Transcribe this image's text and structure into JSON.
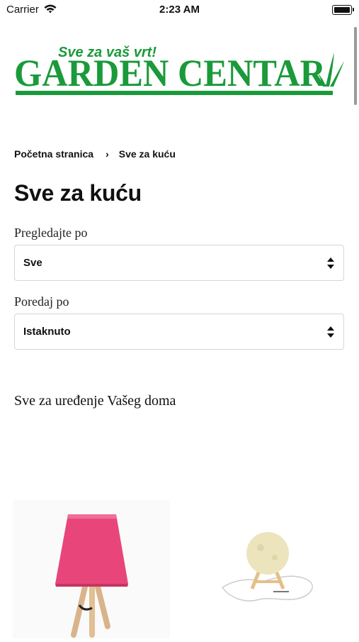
{
  "status": {
    "carrier": "Carrier",
    "time": "2:23 AM"
  },
  "logo": {
    "tagline": "Sve za vaš vrt!",
    "name": "GARDEN CENTAR"
  },
  "breadcrumb": {
    "home": "Početna stranica",
    "separator": "›",
    "current": "Sve za kuću"
  },
  "page": {
    "title": "Sve za kuću",
    "intro": "Sve za  uređenje Vašeg doma"
  },
  "filters": {
    "browse_label": "Pregledajte po",
    "browse_value": "Sve",
    "sort_label": "Poredaj po",
    "sort_value": "Istaknuto"
  },
  "products": [
    {
      "name": "pink-table-lamp"
    },
    {
      "name": "moon-lamp"
    }
  ],
  "colors": {
    "brand_green": "#1a9a3a",
    "lamp_pink": "#e8467a"
  }
}
